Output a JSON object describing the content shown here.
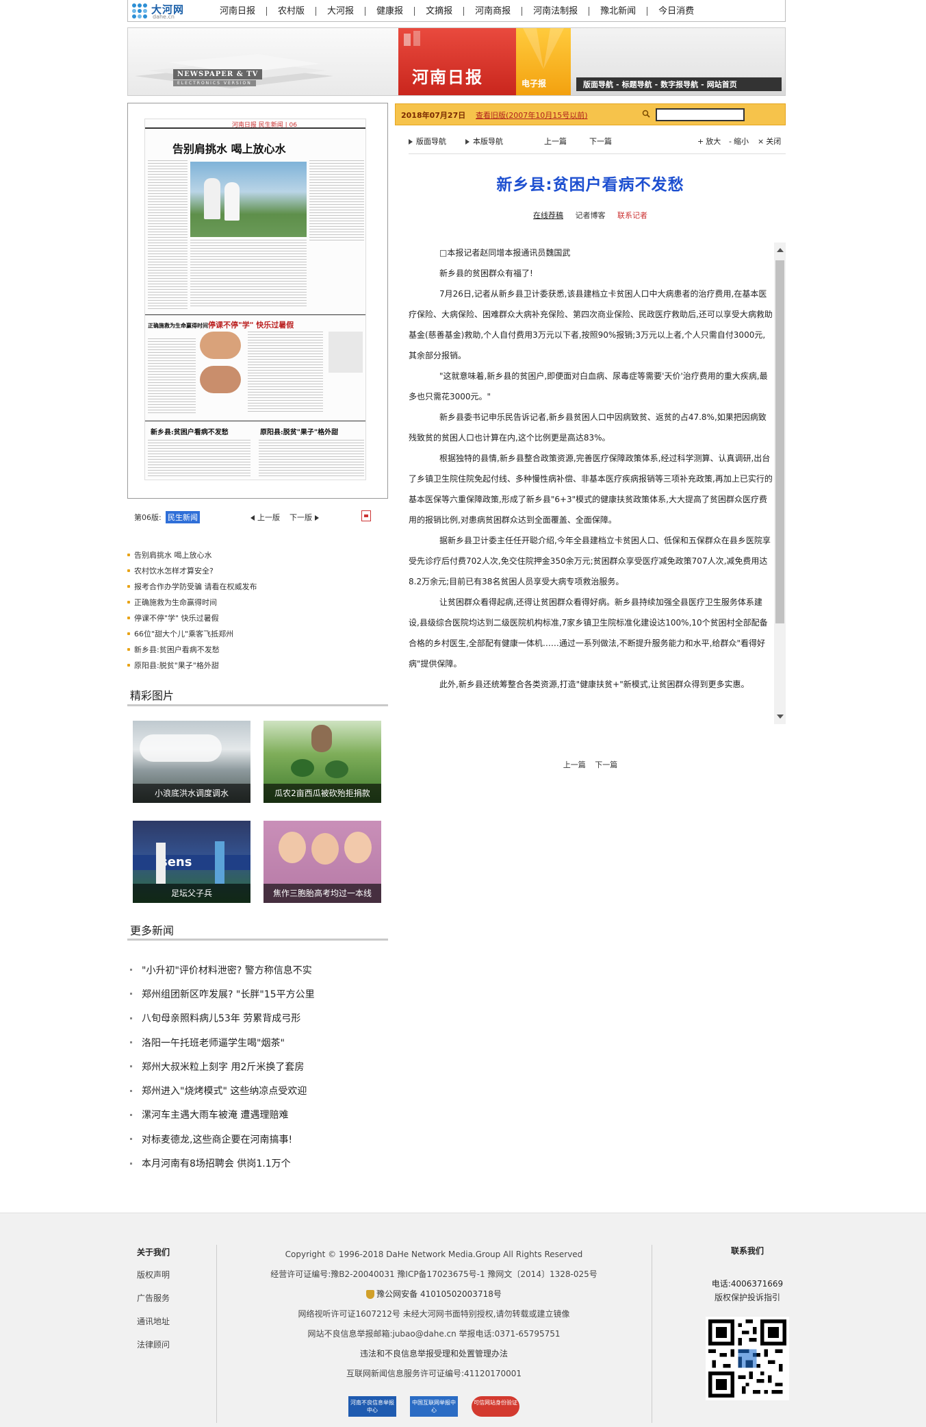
{
  "logo": {
    "brand": "大河网",
    "domain": "dahe.cn"
  },
  "top_nav": [
    "河南日报",
    "农村版",
    "大河报",
    "健康报",
    "文摘报",
    "河南商报",
    "河南法制报",
    "豫北新闻",
    "今日消费"
  ],
  "banner": {
    "newspaper_tv": "NEWSPAPER & TV",
    "electronics_version": "ELECTRONICS VERSION",
    "paper_name": "河南日报",
    "epaper": "电子报",
    "links": [
      "版面导航",
      "标题导航",
      "数字报导航",
      "网站首页"
    ]
  },
  "page_thumb": {
    "header": "河南日报 民生新闻 | 06",
    "headline": "告别肩挑水 喝上放心水",
    "sub1": "停课不停\"学\" 快乐过暑假",
    "sub2": "新乡县:贫困户看病不发愁",
    "sub3": "原阳县:脱贫\"果子\"格外甜",
    "side1": "正确施救为生命赢得时间"
  },
  "page_bar": {
    "label": "第06版:",
    "current": "民生新闻",
    "prev": "上一版",
    "next": "下一版"
  },
  "headlines": [
    "告别肩挑水 喝上放心水",
    "农村饮水怎样才算安全?",
    "报考合作办学防受骗 请看在权威发布",
    "正确施救为生命赢得时间",
    "停课不停\"学\" 快乐过暑假",
    "66位\"甜大个儿\"乘客飞抵郑州",
    "新乡县:贫困户看病不发愁",
    "原阳县:脱贫\"果子\"格外甜"
  ],
  "pictures": {
    "title": "精彩图片",
    "items": [
      {
        "caption": "小浪底洪水调度调水"
      },
      {
        "caption": "瓜农2亩西瓜被砍殆拒捐款"
      },
      {
        "caption": "足坛父子兵"
      },
      {
        "caption": "焦作三胞胎高考均过一本线"
      }
    ]
  },
  "more_news": {
    "title": "更多新闻",
    "items": [
      "\"小升初\"评价材料泄密? 警方称信息不实",
      "郑州组团新区咋发展? \"长胖\"15平方公里",
      "八旬母亲照料病儿53年 劳累背成弓形",
      "洛阳一午托班老师逼学生喝\"烟茶\"",
      "郑州大叔米粒上刻字 用2斤米换了套房",
      "郑州进入\"烧烤模式\" 这些纳凉点受欢迎",
      "漯河车主遇大雨车被淹 遭遇理赔难",
      "对标麦德龙,这些商企要在河南搞事!",
      "本月河南有8场招聘会 供岗1.1万个"
    ]
  },
  "date_bar": {
    "date": "2018年07月27日",
    "old_version": "查看旧版(2007年10月15号以前)"
  },
  "toolbar": {
    "page_nav": "版面导航",
    "this_page_nav": "本版导航",
    "prev": "上一篇",
    "next": "下一篇",
    "zoom_in": "放大",
    "zoom_out": "缩小",
    "close": "关闭"
  },
  "article": {
    "title": "新乡县:贫困户看病不发愁",
    "meta": [
      "在线荐稿",
      "记者博客",
      "联系记者"
    ],
    "paragraphs": [
      "□本报记者赵同增本报通讯员魏国武",
      "新乡县的贫困群众有福了!",
      "7月26日,记者从新乡县卫计委获悉,该县建档立卡贫困人口中大病患者的治疗费用,在基本医疗保险、大病保险、困难群众大病补充保险、第四次商业保险、民政医疗救助后,还可以享受大病救助基金(慈善基金)救助,个人自付费用3万元以下者,按照90%报销;3万元以上者,个人只需自付3000元,其余部分报销。",
      "\"这就意味着,新乡县的贫困户,即便面对白血病、尿毒症等需要'天价'治疗费用的重大疾病,最多也只需花3000元。\"",
      "新乡县委书记申乐民告诉记者,新乡县贫困人口中因病致贫、返贫的占47.8%,如果把因病致残致贫的贫困人口也计算在内,这个比例更是高达83%。",
      "根据独特的县情,新乡县整合政策资源,完善医疗保障政策体系,经过科学测算、认真调研,出台了乡镇卫生院住院免起付线、多种慢性病补偿、非基本医疗疾病报销等三项补充政策,再加上已实行的基本医保等六重保障政策,形成了新乡县\"6+3\"模式的健康扶贫政策体系,大大提高了贫困群众医疗费用的报销比例,对患病贫困群众达到全面覆盖、全面保障。",
      "据新乡县卫计委主任任开聪介绍,今年全县建档立卡贫困人口、低保和五保群众在县乡医院享受先诊疗后付费702人次,免交住院押金350余万元;贫困群众享受医疗减免政策707人次,减免费用达8.2万余元;目前已有38名贫困人员享受大病专项救治服务。",
      "让贫困群众看得起病,还得让贫困群众看得好病。新乡县持续加强全县医疗卫生服务体系建设,县级综合医院均达到二级医院机构标准,7家乡镇卫生院标准化建设达100%,10个贫困村全部配备合格的乡村医生,全部配有健康一体机……通过一系列做法,不断提升服务能力和水平,给群众\"看得好病\"提供保障。",
      "此外,新乡县还统筹整合各类资源,打造\"健康扶贫+\"新模式,让贫困群众得到更多实惠。"
    ]
  },
  "bottom_nav": {
    "prev": "上一篇",
    "next": "下一篇"
  },
  "footer": {
    "about_title": "关于我们",
    "about_links": [
      "版权声明",
      "广告服务",
      "通讯地址",
      "法律顾问"
    ],
    "center_lines": [
      "Copyright © 1996-2018 DaHe Network Media.Group All Rights Reserved",
      "经营许可证编号:豫B2-20040031   豫ICP备17023675号-1   豫网文〔2014〕1328-025号",
      "豫公网安备 41010502003718号",
      "网络视听许可证1607212号 未经大河网书面特别授权,请勿转载或建立镜像",
      "网站不良信息举报邮箱:jubao@dahe.cn   举报电话:0371-65795751",
      "违法和不良信息举报受理和处置管理办法",
      "互联网新闻信息服务许可证编号:41120170001"
    ],
    "badges": [
      "河南不良信息举报中心",
      "中国互联网举报中心",
      "可信网站身份验证"
    ],
    "contact_title": "联系我们",
    "phone": "电话:4006371669",
    "complaint": "版权保护投诉指引"
  }
}
